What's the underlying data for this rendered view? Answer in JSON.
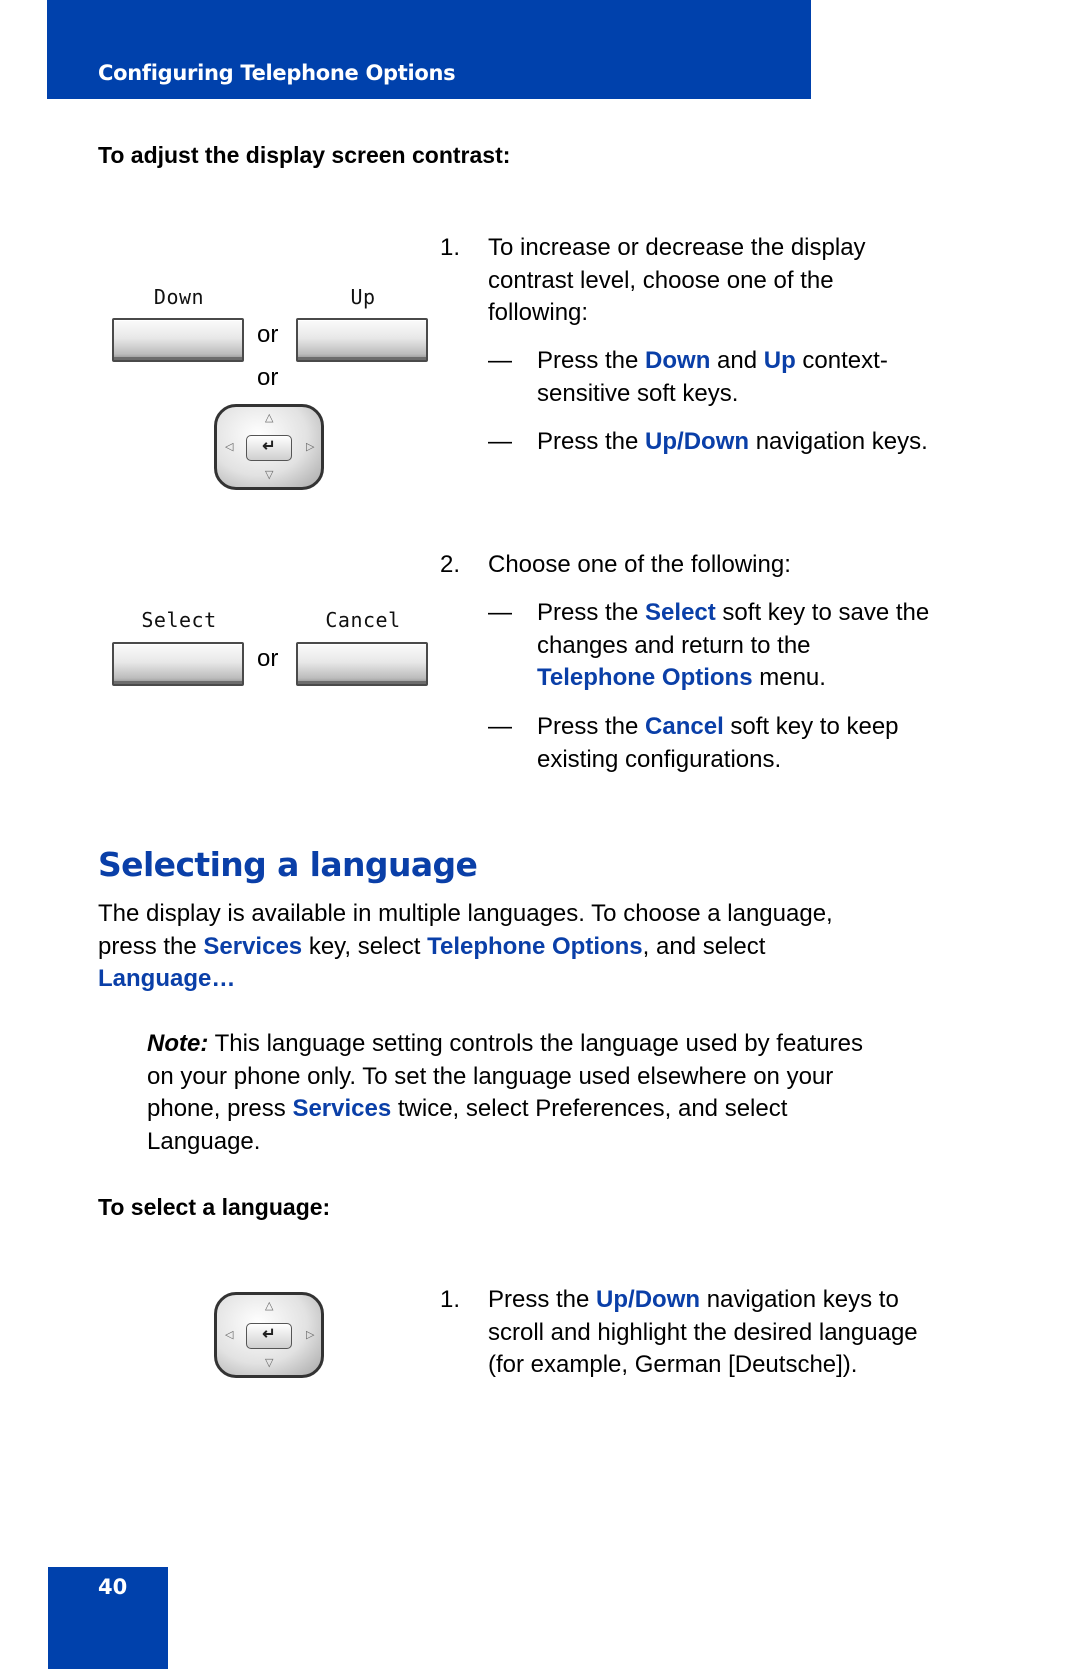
{
  "header": {
    "title": "Configuring Telephone Options"
  },
  "contrast": {
    "title": "To adjust the display screen contrast:",
    "softkeys_row1": {
      "left_label": "Down",
      "right_label": "Up",
      "or1": "or",
      "or2": "or"
    },
    "softkeys_row2": {
      "left_label": "Select",
      "right_label": "Cancel",
      "or": "or"
    },
    "navkey": {
      "up": "△",
      "down": "▽",
      "left": "◁",
      "right": "▷",
      "enter": "↵"
    },
    "step1": {
      "num": "1.",
      "lines": [
        "To increase or decrease the display",
        "contrast level, choose one of the",
        "following:"
      ],
      "bullet1": {
        "dash": "—",
        "pre": "Press the ",
        "k1": "Down",
        "mid": " and ",
        "k2": "Up",
        "post": " context-",
        "line2": "sensitive soft keys."
      },
      "bullet2": {
        "dash": "—",
        "pre": "Press the ",
        "k1": "Up/Down",
        "post": " navigation keys."
      }
    },
    "step2": {
      "num": "2.",
      "text": "Choose one of the following:",
      "bullet1": {
        "dash": "—",
        "pre": "Press the ",
        "k1": "Select",
        "post": " soft key to save the",
        "line2": "changes and return to the",
        "k2": "Telephone Options",
        "line3_post": " menu."
      },
      "bullet2": {
        "dash": "—",
        "pre": "Press the ",
        "k1": "Cancel",
        "post": " soft key to keep",
        "line2": "existing configurations."
      }
    }
  },
  "language": {
    "heading": "Selecting a language",
    "intro": {
      "line1": "The display is available in multiple languages. To choose a language,",
      "l2_pre": "press the ",
      "l2_k1": "Services",
      "l2_mid": " key, select ",
      "l2_k2": "Telephone Options",
      "l2_post": ", and select",
      "l3_k": "Language…"
    },
    "note": {
      "label": "Note:",
      "line1": " This language setting controls the language used by features",
      "line2": "on your phone only. To set the language used elsewhere on your",
      "l3_pre": "phone, press ",
      "l3_k": "Services",
      "l3_post": " twice, select Preferences, and select",
      "line4": "Language."
    },
    "proc_title": "To select a language:",
    "step1": {
      "num": "1.",
      "pre": "Press the ",
      "k1": "Up/Down",
      "post": " navigation keys to",
      "line2": "scroll and highlight the desired language",
      "line3": "(for example, German [Deutsche])."
    }
  },
  "footer": {
    "page_number": "40"
  },
  "colors": {
    "brand_blue": "#0041ac",
    "link_blue": "#0a3fa8"
  }
}
